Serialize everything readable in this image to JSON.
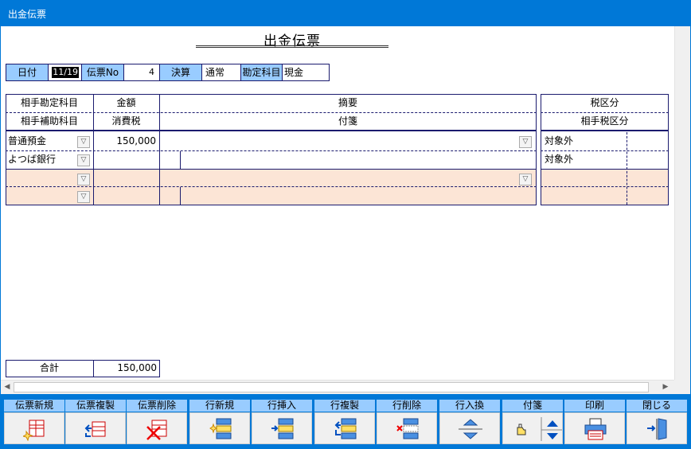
{
  "window": {
    "title": "出金伝票"
  },
  "document": {
    "title": "出金伝票"
  },
  "header_fields": {
    "date_label": "日付",
    "date_value": "11/19",
    "slip_no_label": "伝票No",
    "slip_no_value": "4",
    "settlement_label": "決算",
    "settlement_value": "通常",
    "account_label": "勘定科目",
    "account_value": "現金"
  },
  "grid": {
    "col_headers": {
      "counter_account": "相手勘定科目",
      "counter_sub_account": "相手補助科目",
      "amount": "金額",
      "consumption_tax": "消費税",
      "summary": "摘要",
      "sticky_note": "付箋",
      "tax_category": "税区分",
      "counter_tax_category": "相手税区分"
    },
    "rows": [
      {
        "account": "普通預金",
        "sub_account": "よつば銀行",
        "amount": "150,000",
        "tax": "",
        "summary": "",
        "note": "",
        "tax_category": "対象外",
        "counter_tax_category": "対象外"
      },
      {
        "account": "",
        "sub_account": "",
        "amount": "",
        "tax": "",
        "summary": "",
        "note": "",
        "tax_category": "",
        "counter_tax_category": ""
      }
    ]
  },
  "total": {
    "label": "合計",
    "value": "150,000"
  },
  "toolbar": {
    "buttons": [
      "伝票新規",
      "伝票複製",
      "伝票削除",
      "行新規",
      "行挿入",
      "行複製",
      "行削除",
      "行入換",
      "付箋",
      "印刷",
      "閉じる"
    ]
  },
  "colors": {
    "titlebar": "#0078d7",
    "label_bg": "#99ccff",
    "new_row_bg": "#fce5d6",
    "grid_line": "#1a1a6e"
  }
}
